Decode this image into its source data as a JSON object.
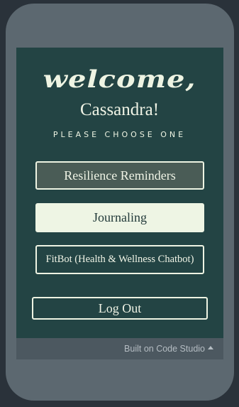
{
  "header": {
    "welcome": "welcome,",
    "name": "Cassandra!",
    "subtitle": "PLEASE CHOOSE ONE"
  },
  "menu": {
    "resilience": "Resilience Reminders",
    "journaling": "Journaling",
    "fitbot": "FitBot (Health & Wellness Chatbot)",
    "logout": "Log Out"
  },
  "footer": {
    "text": "Built on Code Studio",
    "icon": "caret-up-icon"
  },
  "colors": {
    "screen_bg": "#234444",
    "device_bg": "#5c6870",
    "accent_light": "#eef5e4"
  }
}
